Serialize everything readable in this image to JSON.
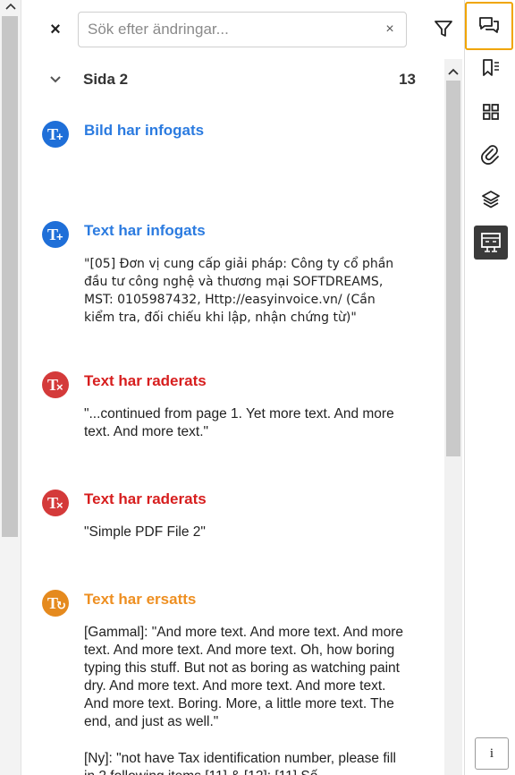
{
  "search": {
    "placeholder": "Sök efter ändringar...",
    "value": "",
    "clear_glyph": "×"
  },
  "header": {
    "close_glyph": "×",
    "filter_icon": "filter-icon"
  },
  "page_group": {
    "label": "Sida 2",
    "count": "13",
    "expanded": true
  },
  "changes": [
    {
      "kind": "image-inserted",
      "color": "#1f6fd8",
      "title": "Bild har infogats",
      "body": ""
    },
    {
      "kind": "text-inserted",
      "color": "#1f6fd8",
      "title": "Text har infogats",
      "body": "\"[05] Đơn vị cung cấp giải pháp: Công ty cổ phần đầu tư công nghệ và thương mại SOFTDREAMS, MST: 0105987432, Http://easyinvoice.vn/ (Cần kiểm tra, đối chiếu khi lập, nhận chứng từ)\""
    },
    {
      "kind": "text-deleted",
      "color": "#d43a3a",
      "title": "Text har raderats",
      "body": "\"...continued from page 1. Yet more text. And more text. And more text.\""
    },
    {
      "kind": "text-deleted",
      "color": "#d43a3a",
      "title": "Text har raderats",
      "body": "\"Simple PDF File 2\""
    },
    {
      "kind": "text-replaced",
      "color": "#e58a1e",
      "title": "Text har ersatts",
      "body": "[Gammal]: \"And more text. And more text. And more text. And more text. And more  text. Oh, how boring typing this stuff. But not as boring as watching  paint dry. And more text. And more text. And more text. And more text.  Boring. More, a little more text. The end, and just as well.\"",
      "body2": "[Ny]: \"not have Tax identification number, please fill in 2 following items [11] & [12]: [11] Số"
    }
  ],
  "rail": {
    "items": [
      "comments-icon",
      "bookmarks-icon",
      "thumbnails-icon",
      "attachments-icon",
      "layers-icon",
      "compare-icon"
    ],
    "selected": "comments-icon",
    "active": "compare-icon",
    "info_label": "i"
  }
}
